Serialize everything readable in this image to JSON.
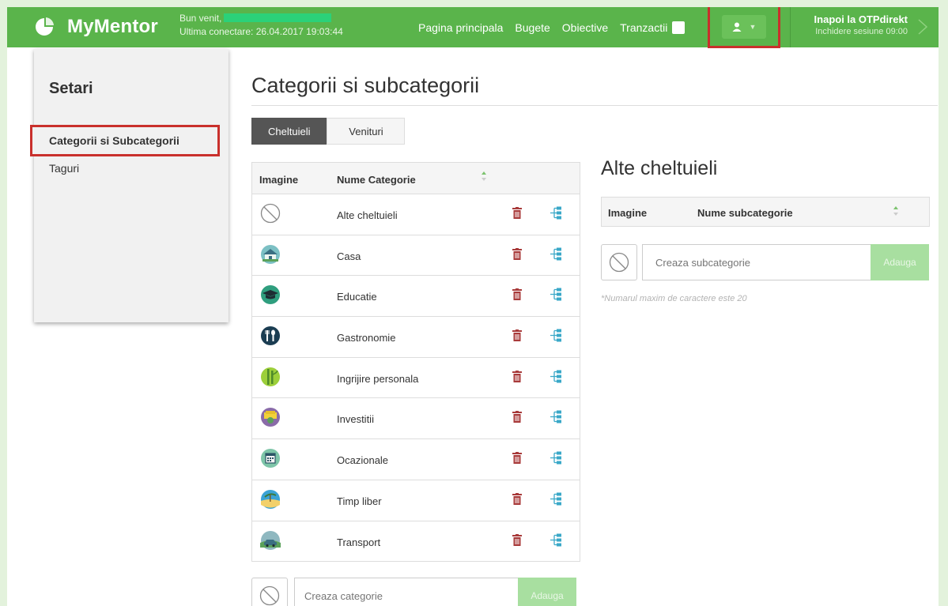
{
  "app": {
    "name": "MyMentor",
    "welcome": "Bun venit,",
    "last_login": "Ultima conectare: 26.04.2017 19:03:44"
  },
  "nav": {
    "home": "Pagina principala",
    "budgets": "Bugete",
    "goals": "Obiective",
    "transactions": "Tranzactii",
    "plus": "+"
  },
  "header_right": {
    "back_label": "Inapoi la OTPdirekt",
    "session": "Inchidere sesiune 09:00"
  },
  "sidebar": {
    "title": "Setari",
    "items": [
      {
        "label": "Categorii si Subcategorii"
      },
      {
        "label": "Taguri"
      }
    ]
  },
  "main": {
    "title": "Categorii si subcategorii",
    "tabs": [
      {
        "label": "Cheltuieli"
      },
      {
        "label": "Venituri"
      }
    ],
    "table": {
      "headers": [
        "Imagine",
        "Nume Categorie"
      ],
      "rows": [
        {
          "name": "Alte cheltuieli",
          "icon": "no-image-icon"
        },
        {
          "name": "Casa",
          "icon": "house-icon"
        },
        {
          "name": "Educatie",
          "icon": "graduation-cap-icon"
        },
        {
          "name": "Gastronomie",
          "icon": "fork-spoon-icon"
        },
        {
          "name": "Ingrijire personala",
          "icon": "bamboo-icon"
        },
        {
          "name": "Investitii",
          "icon": "money-icon"
        },
        {
          "name": "Ocazionale",
          "icon": "calendar-icon"
        },
        {
          "name": "Timp liber",
          "icon": "beach-icon"
        },
        {
          "name": "Transport",
          "icon": "car-icon"
        }
      ]
    },
    "add_category": {
      "placeholder": "Creaza categorie",
      "button": "Adauga"
    }
  },
  "subpanel": {
    "title": "Alte cheltuieli",
    "headers": [
      "Imagine",
      "Nume subcategorie"
    ],
    "placeholder": "Creaza subcategorie",
    "button": "Adauga",
    "hint": "*Numarul maxim de caractere este 20"
  },
  "colors": {
    "topbar": "#5ab44b",
    "highlight": "#c9302c",
    "add_button": "#a8dfa0",
    "trash": "#a83a3a",
    "tree": "#3aa8c8"
  }
}
